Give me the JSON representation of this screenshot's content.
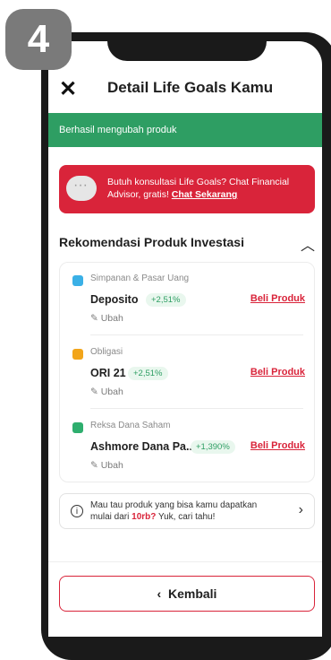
{
  "step": "4",
  "header": {
    "title": "Detail Life Goals Kamu"
  },
  "toast": "Berhasil mengubah produk",
  "promo": {
    "text": "Butuh konsultasi Life Goals? Chat Financial Advisor, gratis!",
    "link": "Chat Sekarang"
  },
  "section": {
    "title": "Rekomendasi Produk Investasi"
  },
  "products": [
    {
      "category": "Simpanan & Pasar Uang",
      "name": "Deposito",
      "rate": "+2,51%",
      "buy": "Beli Produk",
      "edit": "Ubah",
      "color": "#3ab0e6"
    },
    {
      "category": "Obligasi",
      "name": "ORI 21",
      "rate": "+2,51%",
      "buy": "Beli Produk",
      "edit": "Ubah",
      "color": "#f2a51a"
    },
    {
      "category": "Reksa Dana Saham",
      "name": "Ashmore Dana Pa...",
      "rate": "+1,390%",
      "buy": "Beli Produk",
      "edit": "Ubah",
      "color": "#2eae6e"
    }
  ],
  "info": {
    "line1": "Mau tau produk yang bisa kamu dapatkan",
    "line2_prefix": "mulai dari",
    "highlight": "10rb?",
    "line2_suffix": "Yuk, cari tahu!"
  },
  "back_button": "Kembali"
}
